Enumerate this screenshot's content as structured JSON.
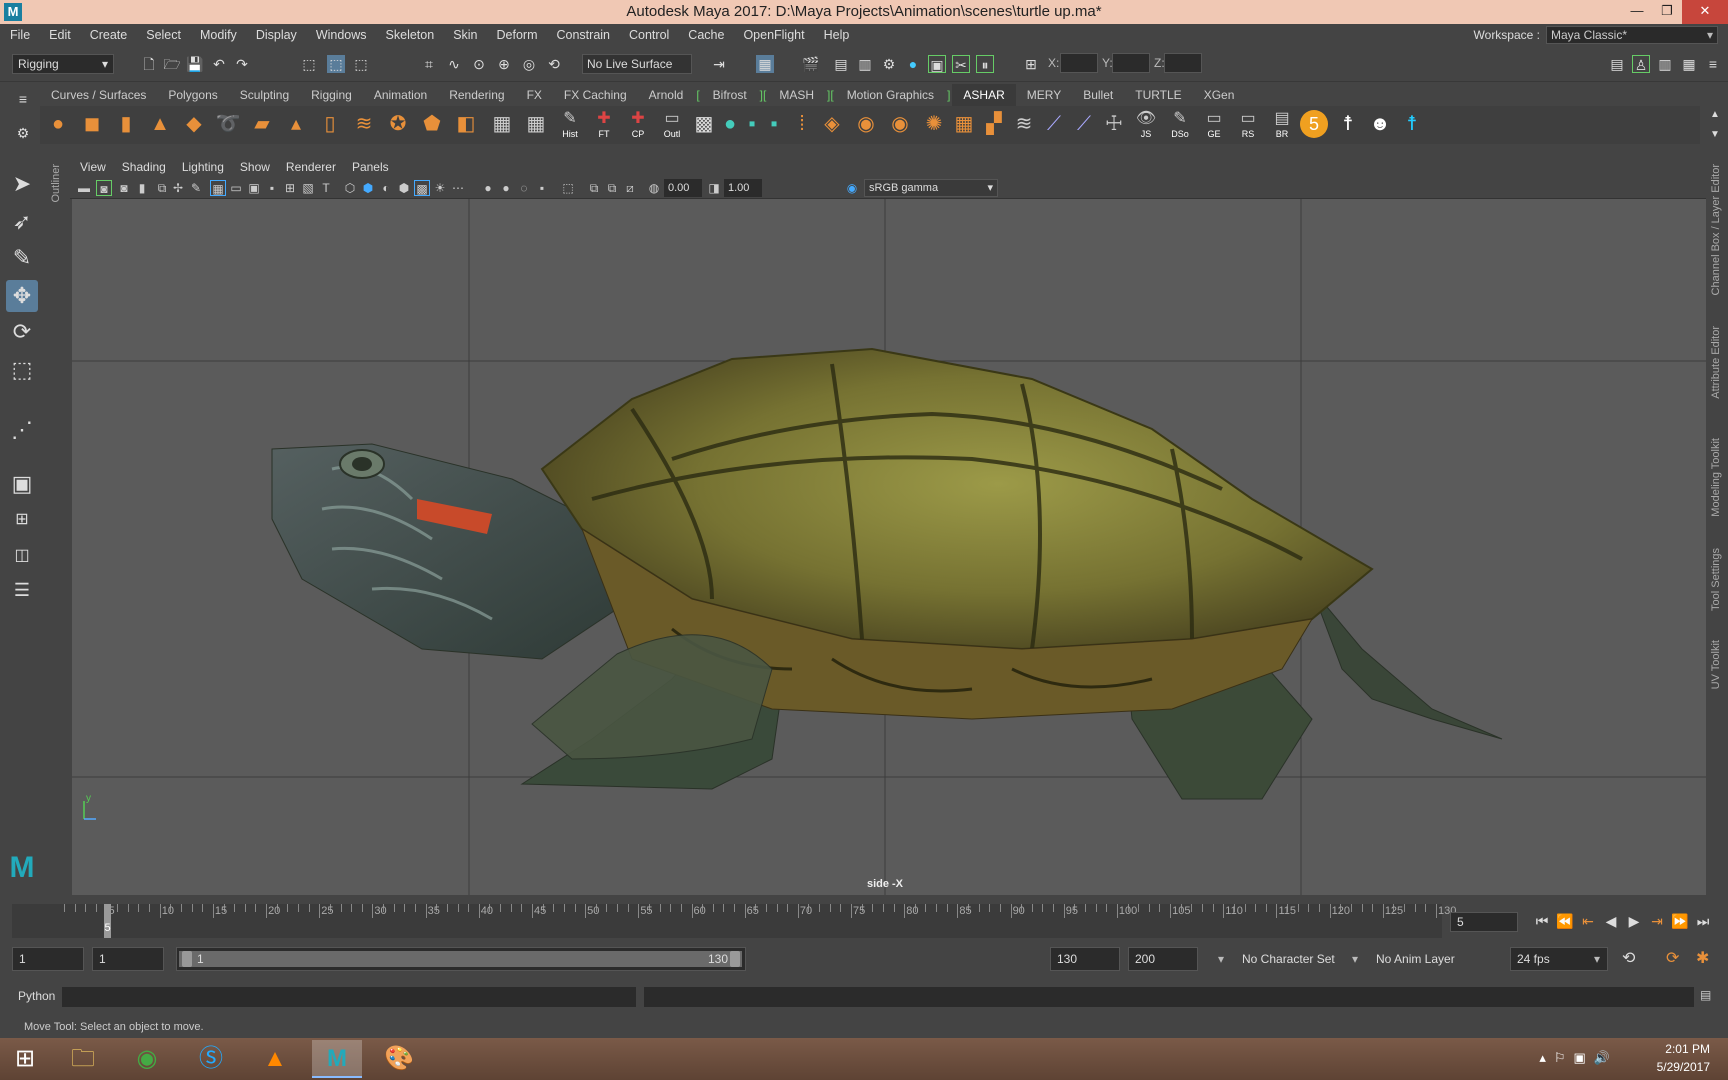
{
  "window": {
    "title": "Autodesk Maya 2017: D:\\Maya Projects\\Animation\\scenes\\turtle up.ma*",
    "app_icon": "M"
  },
  "menubar": [
    "File",
    "Edit",
    "Create",
    "Select",
    "Modify",
    "Display",
    "Windows",
    "Skeleton",
    "Skin",
    "Deform",
    "Constrain",
    "Control",
    "Cache",
    "OpenFlight",
    "Help"
  ],
  "workspace": {
    "label": "Workspace :",
    "value": "Maya Classic*"
  },
  "status": {
    "mode": "Rigging",
    "live_surface": "No Live Surface",
    "x_label": "X:",
    "y_label": "Y:",
    "z_label": "Z:"
  },
  "shelf_tabs": [
    {
      "label": "Curves / Surfaces"
    },
    {
      "label": "Polygons"
    },
    {
      "label": "Sculpting"
    },
    {
      "label": "Rigging"
    },
    {
      "label": "Animation"
    },
    {
      "label": "Rendering"
    },
    {
      "label": "FX"
    },
    {
      "label": "FX Caching"
    },
    {
      "label": "Arnold"
    },
    {
      "label": "Bifrost"
    },
    {
      "label": "MASH"
    },
    {
      "label": "Motion Graphics"
    },
    {
      "label": "ASHAR",
      "active": true
    },
    {
      "label": "MERY"
    },
    {
      "label": "Bullet"
    },
    {
      "label": "TURTLE"
    },
    {
      "label": "XGen"
    }
  ],
  "shelf_labels": {
    "hist": "Hist",
    "ft": "FT",
    "cp": "CP",
    "outl": "Outl",
    "js": "JS",
    "dso": "DSo",
    "ge": "GE",
    "rs": "RS",
    "br": "BR",
    "five": "5"
  },
  "panel_menu": [
    "View",
    "Shading",
    "Lighting",
    "Show",
    "Renderer",
    "Panels"
  ],
  "panel_toolbar": {
    "exposure": "0.00",
    "gamma": "1.00",
    "colorspace": "sRGB gamma"
  },
  "viewport": {
    "camera_label": "side -X",
    "axis_label": "y"
  },
  "side_strips": {
    "outliner": "Outliner",
    "right": [
      "Channel Box / Layer Editor",
      "Attribute Editor",
      "Modeling Toolkit",
      "Tool Settings",
      "UV Toolkit"
    ]
  },
  "timeline": {
    "ticks": [
      5,
      10,
      15,
      20,
      25,
      30,
      35,
      40,
      45,
      50,
      55,
      60,
      65,
      70,
      75,
      80,
      85,
      90,
      95,
      100,
      105,
      110,
      115,
      120,
      125,
      130
    ],
    "current_frame": "5",
    "current_frame_box": "5"
  },
  "range": {
    "start": "1",
    "playback_start": "1",
    "range_start_label": "1",
    "range_end_label": "130",
    "playback_end": "130",
    "end": "200",
    "character_set": "No Character Set",
    "anim_layer": "No Anim Layer",
    "fps": "24 fps"
  },
  "cmdline": {
    "label": "Python"
  },
  "help_line": "Move Tool: Select an object to move.",
  "taskbar": {
    "time": "2:01 PM",
    "date": "5/29/2017"
  }
}
